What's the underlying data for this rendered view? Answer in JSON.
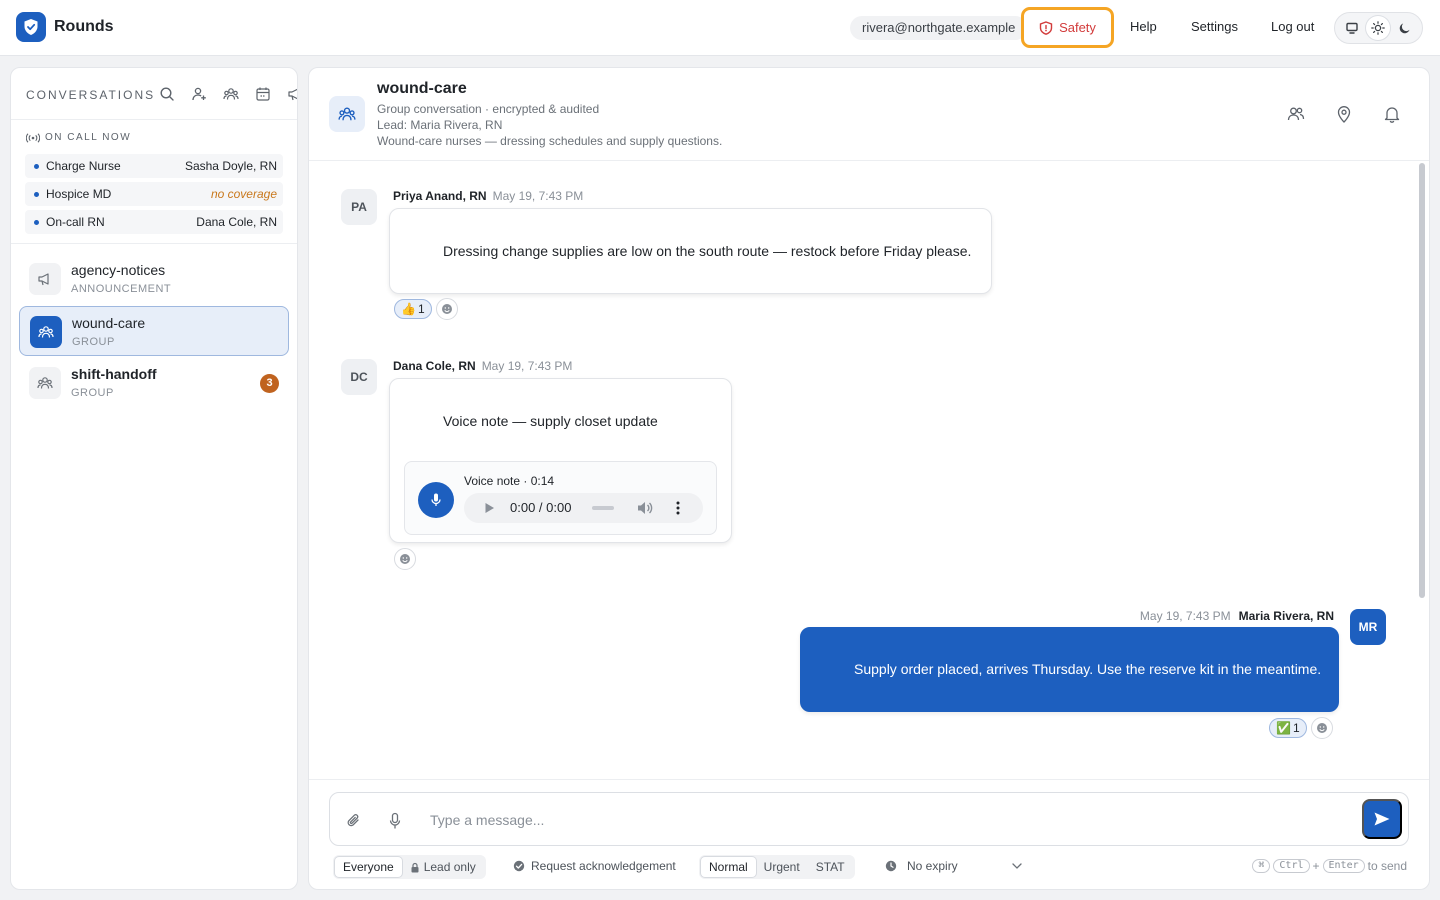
{
  "app": {
    "name": "Rounds"
  },
  "topbar": {
    "user_email": "rivera@northgate.example",
    "safety_label": "Safety",
    "help_label": "Help",
    "settings_label": "Settings",
    "logout_label": "Log out",
    "theme_modes": [
      "monitor-icon",
      "sun-icon",
      "moon-icon"
    ]
  },
  "sidebar": {
    "title": "CONVERSATIONS",
    "on_call_title": "ON CALL NOW",
    "on_call": [
      {
        "role": "Charge Nurse",
        "person": "Sasha Doyle, RN"
      },
      {
        "role": "Hospice MD",
        "person": "no coverage"
      },
      {
        "role": "On-call RN",
        "person": "Dana Cole, RN"
      }
    ],
    "conversations": [
      {
        "name": "agency-notices",
        "type": "ANNOUNCEMENT",
        "icon": "megaphone-icon"
      },
      {
        "name": "wound-care",
        "type": "GROUP",
        "icon": "group-icon"
      },
      {
        "name": "shift-handoff",
        "type": "GROUP",
        "icon": "group-icon",
        "unread": "3"
      }
    ]
  },
  "channel": {
    "title": "wound-care",
    "subtitle": "Group conversation · encrypted & audited",
    "lead": "Lead: Maria Rivera, RN",
    "description": "Wound-care nurses — dressing schedules and supply questions."
  },
  "messages": [
    {
      "initials": "PA",
      "author": "Priya Anand, RN",
      "time": "May 19, 7:43 PM",
      "text": "Dressing change supplies are low on the south route — restock before Friday please.",
      "reaction": {
        "emoji": "👍",
        "count": "1"
      }
    },
    {
      "initials": "DC",
      "author": "Dana Cole, RN",
      "time": "May 19, 7:43 PM",
      "text": "Voice note — supply closet update",
      "voice": {
        "label": "Voice note · 0:14",
        "time": "0:00 / 0:00"
      }
    },
    {
      "initials": "MR",
      "author": "Maria Rivera, RN",
      "time": "May 19, 7:43 PM",
      "text": "Supply order placed, arrives Thursday. Use the reserve kit in the meantime.",
      "reaction": {
        "emoji": "✅",
        "count": "1"
      }
    }
  ],
  "composer": {
    "placeholder": "Type a message...",
    "audience": [
      "Everyone",
      "Lead only"
    ],
    "ack_label": "Request acknowledgement",
    "priority": [
      "Normal",
      "Urgent",
      "STAT"
    ],
    "expiry_label": "No expiry",
    "shortcut_keys": [
      "⌘",
      "Ctrl",
      "Enter"
    ],
    "shortcut_plus": "+",
    "shortcut_suffix": "to send"
  },
  "colors": {
    "accent": "#1d5fbf",
    "safety": "#d23b3b",
    "highlight": "#f5a524",
    "badge": "#c0631f"
  }
}
